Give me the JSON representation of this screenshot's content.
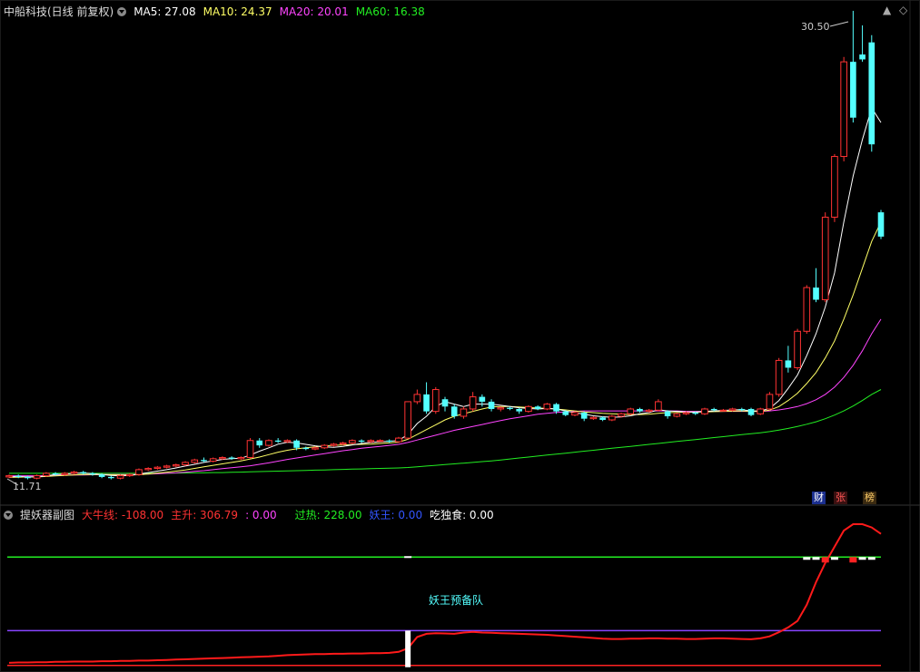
{
  "main_panel": {
    "stock": "中船科技(日线 前复权)",
    "ma": [
      {
        "label": "MA5: 27.08",
        "color": "#ffffff"
      },
      {
        "label": "MA10: 24.37",
        "color": "#ffff66"
      },
      {
        "label": "MA20: 20.01",
        "color": "#ff44ff"
      },
      {
        "label": "MA60: 16.38",
        "color": "#22ee22"
      }
    ],
    "high_label": "30.50",
    "low_label": "11.71",
    "badges": [
      {
        "text": "财",
        "color": "#ffffff",
        "bg": "#1b2f8f"
      },
      {
        "text": "张",
        "color": "#ff5555",
        "bg": "#3a1111"
      },
      {
        "text": "榜",
        "color": "#ffcc66",
        "bg": "#3a2a11"
      }
    ]
  },
  "sub_panel": {
    "name": "提妖器副图",
    "fields": [
      {
        "label": "大牛线: -108.00",
        "color": "#ff3333"
      },
      {
        "label": "主升: 306.79",
        "color": "#ff3333"
      },
      {
        "label": ": 0.00",
        "color": "#ff44ff"
      },
      {
        "label": "过热: 228.00",
        "color": "#22ee22"
      },
      {
        "label": "妖王: 0.00",
        "color": "#3355ff"
      },
      {
        "label": "吃独食: 0.00",
        "color": "#ffffff"
      }
    ],
    "annotation": "妖王预备队"
  },
  "colors": {
    "up": "#ff3333",
    "down": "#54ffff",
    "bg": "#000000"
  },
  "chart_data": {
    "type": "candlestick",
    "price_range": [
      11.71,
      30.5
    ],
    "candles": [
      [
        11.9,
        11.95,
        12.0,
        11.85
      ],
      [
        11.95,
        11.9,
        12.0,
        11.85
      ],
      [
        11.9,
        11.85,
        11.95,
        11.8
      ],
      [
        11.85,
        11.95,
        12.0,
        11.8
      ],
      [
        11.95,
        12.05,
        12.1,
        11.9
      ],
      [
        12.05,
        12.0,
        12.1,
        11.95
      ],
      [
        12.0,
        12.05,
        12.1,
        11.95
      ],
      [
        12.05,
        12.1,
        12.15,
        12.0
      ],
      [
        12.1,
        12.05,
        12.15,
        12.0
      ],
      [
        12.05,
        12.0,
        12.1,
        11.95
      ],
      [
        12.0,
        11.9,
        12.05,
        11.85
      ],
      [
        11.9,
        11.85,
        11.95,
        11.8
      ],
      [
        11.85,
        11.95,
        12.0,
        11.8
      ],
      [
        11.95,
        12.0,
        12.05,
        11.9
      ],
      [
        12.0,
        12.2,
        12.25,
        11.95
      ],
      [
        12.2,
        12.25,
        12.3,
        12.15
      ],
      [
        12.25,
        12.3,
        12.35,
        12.2
      ],
      [
        12.3,
        12.35,
        12.4,
        12.25
      ],
      [
        12.35,
        12.4,
        12.45,
        12.3
      ],
      [
        12.4,
        12.5,
        12.55,
        12.35
      ],
      [
        12.5,
        12.6,
        12.65,
        12.45
      ],
      [
        12.6,
        12.55,
        12.7,
        12.5
      ],
      [
        12.55,
        12.65,
        12.7,
        12.5
      ],
      [
        12.65,
        12.7,
        12.75,
        12.6
      ],
      [
        12.7,
        12.65,
        12.75,
        12.6
      ],
      [
        12.65,
        12.7,
        12.75,
        12.6
      ],
      [
        12.7,
        13.4,
        13.5,
        12.65
      ],
      [
        13.4,
        13.2,
        13.5,
        13.1
      ],
      [
        13.2,
        13.4,
        13.45,
        13.15
      ],
      [
        13.4,
        13.35,
        13.5,
        13.3
      ],
      [
        13.35,
        13.4,
        13.45,
        13.3
      ],
      [
        13.4,
        13.1,
        13.45,
        13.0
      ],
      [
        13.1,
        13.05,
        13.15,
        13.0
      ],
      [
        13.05,
        13.1,
        13.15,
        13.0
      ],
      [
        13.1,
        13.2,
        13.25,
        13.05
      ],
      [
        13.2,
        13.25,
        13.3,
        13.15
      ],
      [
        13.25,
        13.3,
        13.35,
        13.2
      ],
      [
        13.3,
        13.4,
        13.45,
        13.25
      ],
      [
        13.4,
        13.35,
        13.45,
        13.3
      ],
      [
        13.35,
        13.4,
        13.45,
        13.3
      ],
      [
        13.4,
        13.4,
        13.45,
        13.35
      ],
      [
        13.4,
        13.35,
        13.45,
        13.3
      ],
      [
        13.35,
        13.5,
        13.55,
        13.3
      ],
      [
        13.5,
        15.0,
        15.0,
        13.45
      ],
      [
        15.0,
        15.3,
        15.5,
        14.9
      ],
      [
        15.3,
        14.6,
        15.8,
        14.5
      ],
      [
        14.6,
        15.5,
        15.6,
        14.5
      ],
      [
        15.1,
        14.8,
        15.2,
        14.6
      ],
      [
        14.8,
        14.4,
        14.9,
        14.3
      ],
      [
        14.4,
        14.7,
        14.8,
        14.3
      ],
      [
        14.7,
        15.2,
        15.4,
        14.6
      ],
      [
        15.2,
        15.0,
        15.3,
        14.8
      ],
      [
        15.0,
        14.7,
        15.1,
        14.6
      ],
      [
        14.7,
        14.75,
        14.8,
        14.6
      ],
      [
        14.75,
        14.7,
        14.8,
        14.65
      ],
      [
        14.7,
        14.6,
        14.75,
        14.5
      ],
      [
        14.6,
        14.8,
        14.85,
        14.55
      ],
      [
        14.8,
        14.7,
        14.85,
        14.65
      ],
      [
        14.7,
        14.9,
        14.95,
        14.65
      ],
      [
        14.9,
        14.6,
        14.95,
        14.5
      ],
      [
        14.6,
        14.45,
        14.65,
        14.4
      ],
      [
        14.45,
        14.55,
        14.6,
        14.4
      ],
      [
        14.55,
        14.3,
        14.6,
        14.2
      ],
      [
        14.3,
        14.35,
        14.4,
        14.25
      ],
      [
        14.35,
        14.25,
        14.4,
        14.2
      ],
      [
        14.25,
        14.4,
        14.45,
        14.2
      ],
      [
        14.4,
        14.5,
        14.55,
        14.35
      ],
      [
        14.5,
        14.7,
        14.75,
        14.45
      ],
      [
        14.7,
        14.6,
        14.75,
        14.55
      ],
      [
        14.6,
        14.65,
        14.7,
        14.55
      ],
      [
        14.65,
        15.0,
        15.1,
        14.6
      ],
      [
        14.6,
        14.4,
        14.65,
        14.3
      ],
      [
        14.4,
        14.5,
        14.55,
        14.35
      ],
      [
        14.5,
        14.55,
        14.6,
        14.45
      ],
      [
        14.55,
        14.5,
        14.6,
        14.45
      ],
      [
        14.5,
        14.7,
        14.75,
        14.45
      ],
      [
        14.7,
        14.65,
        14.75,
        14.6
      ],
      [
        14.65,
        14.65,
        14.7,
        14.6
      ],
      [
        14.65,
        14.7,
        14.75,
        14.6
      ],
      [
        14.7,
        14.65,
        14.75,
        14.6
      ],
      [
        14.7,
        14.45,
        14.75,
        14.4
      ],
      [
        14.5,
        14.7,
        14.75,
        14.45
      ],
      [
        14.7,
        15.3,
        15.4,
        14.65
      ],
      [
        15.3,
        16.7,
        16.8,
        15.2
      ],
      [
        16.7,
        16.4,
        17.3,
        16.2
      ],
      [
        16.4,
        17.9,
        18.0,
        16.3
      ],
      [
        17.9,
        19.7,
        19.8,
        17.8
      ],
      [
        19.7,
        19.2,
        20.5,
        19.1
      ],
      [
        19.2,
        22.6,
        22.8,
        19.1
      ],
      [
        22.6,
        25.1,
        25.2,
        22.4
      ],
      [
        25.1,
        29.0,
        29.2,
        24.9
      ],
      [
        29.0,
        26.7,
        31.1,
        26.5
      ],
      [
        29.3,
        29.1,
        30.5,
        29.0
      ],
      [
        29.8,
        25.6,
        30.1,
        25.3
      ],
      [
        22.8,
        21.8,
        22.9,
        21.7
      ]
    ],
    "ma5": [
      11.9,
      11.92,
      11.9,
      11.9,
      11.95,
      12,
      12.02,
      12.05,
      12.06,
      12.04,
      12,
      11.96,
      11.95,
      11.96,
      12.02,
      12.08,
      12.14,
      12.2,
      12.27,
      12.35,
      12.42,
      12.5,
      12.56,
      12.62,
      12.65,
      12.67,
      12.8,
      12.96,
      13.1,
      13.25,
      13.33,
      13.3,
      13.24,
      13.18,
      13.14,
      13.12,
      13.16,
      13.22,
      13.28,
      13.32,
      13.35,
      13.37,
      13.4,
      13.65,
      14.1,
      14.4,
      14.8,
      15.0,
      14.9,
      14.8,
      14.9,
      14.9,
      14.9,
      14.85,
      14.8,
      14.75,
      14.72,
      14.7,
      14.72,
      14.7,
      14.62,
      14.55,
      14.48,
      14.42,
      14.38,
      14.36,
      14.37,
      14.42,
      14.5,
      14.55,
      14.67,
      14.62,
      14.6,
      14.58,
      14.57,
      14.6,
      14.62,
      14.64,
      14.66,
      14.67,
      14.62,
      14.62,
      14.72,
      15.05,
      15.55,
      16.1,
      16.9,
      17.8,
      18.9,
      20.3,
      22.4,
      24.3,
      25.8,
      27.1,
      26.5
    ],
    "ma10": [
      11.88,
      11.89,
      11.9,
      11.9,
      11.92,
      11.94,
      11.96,
      11.98,
      12.0,
      12.0,
      12.0,
      11.99,
      11.98,
      11.98,
      11.99,
      12.02,
      12.06,
      12.1,
      12.14,
      12.19,
      12.25,
      12.32,
      12.38,
      12.44,
      12.5,
      12.56,
      12.64,
      12.72,
      12.82,
      12.92,
      13.0,
      13.06,
      13.1,
      13.14,
      13.18,
      13.2,
      13.22,
      13.23,
      13.24,
      13.25,
      13.28,
      13.3,
      13.33,
      13.45,
      13.65,
      13.85,
      14.05,
      14.25,
      14.4,
      14.5,
      14.6,
      14.7,
      14.78,
      14.8,
      14.8,
      14.78,
      14.76,
      14.74,
      14.72,
      14.7,
      14.66,
      14.62,
      14.58,
      14.55,
      14.52,
      14.5,
      14.48,
      14.47,
      14.47,
      14.48,
      14.52,
      14.55,
      14.56,
      14.57,
      14.57,
      14.58,
      14.59,
      14.6,
      14.61,
      14.62,
      14.6,
      14.6,
      14.65,
      14.8,
      15.05,
      15.35,
      15.75,
      16.2,
      16.8,
      17.5,
      18.4,
      19.4,
      20.5,
      21.6,
      22.4
    ],
    "ma20": [
      11.95,
      11.95,
      11.95,
      11.95,
      11.95,
      11.96,
      11.97,
      11.98,
      11.98,
      11.99,
      12.0,
      12.0,
      12.0,
      12.0,
      12.01,
      12.02,
      12.03,
      12.05,
      12.07,
      12.1,
      12.13,
      12.16,
      12.2,
      12.24,
      12.28,
      12.32,
      12.36,
      12.42,
      12.48,
      12.55,
      12.62,
      12.68,
      12.74,
      12.8,
      12.86,
      12.92,
      12.98,
      13.03,
      13.08,
      13.12,
      13.16,
      13.2,
      13.24,
      13.32,
      13.42,
      13.52,
      13.62,
      13.72,
      13.82,
      13.9,
      13.98,
      14.06,
      14.14,
      14.22,
      14.3,
      14.36,
      14.42,
      14.48,
      14.52,
      14.56,
      14.58,
      14.6,
      14.62,
      14.62,
      14.62,
      14.62,
      14.62,
      14.62,
      14.62,
      14.62,
      14.62,
      14.62,
      14.62,
      14.6,
      14.6,
      14.6,
      14.6,
      14.6,
      14.6,
      14.6,
      14.6,
      14.6,
      14.62,
      14.66,
      14.72,
      14.8,
      14.92,
      15.08,
      15.3,
      15.6,
      16.0,
      16.5,
      17.1,
      17.8,
      18.4
    ],
    "ma60": [
      12.05,
      12.05,
      12.05,
      12.05,
      12.05,
      12.05,
      12.05,
      12.05,
      12.05,
      12.05,
      12.05,
      12.05,
      12.05,
      12.05,
      12.05,
      12.05,
      12.05,
      12.05,
      12.06,
      12.06,
      12.07,
      12.07,
      12.08,
      12.08,
      12.09,
      12.1,
      12.11,
      12.12,
      12.13,
      12.14,
      12.15,
      12.16,
      12.17,
      12.18,
      12.19,
      12.2,
      12.21,
      12.22,
      12.23,
      12.24,
      12.25,
      12.26,
      12.27,
      12.29,
      12.32,
      12.35,
      12.38,
      12.41,
      12.44,
      12.47,
      12.5,
      12.53,
      12.56,
      12.6,
      12.64,
      12.68,
      12.72,
      12.76,
      12.8,
      12.84,
      12.88,
      12.92,
      12.96,
      13.0,
      13.04,
      13.08,
      13.12,
      13.16,
      13.2,
      13.24,
      13.28,
      13.32,
      13.36,
      13.4,
      13.44,
      13.48,
      13.52,
      13.56,
      13.6,
      13.64,
      13.68,
      13.72,
      13.77,
      13.83,
      13.9,
      13.98,
      14.07,
      14.17,
      14.3,
      14.45,
      14.62,
      14.82,
      15.05,
      15.3,
      15.5
    ],
    "sub_line": [
      -100,
      -99,
      -99,
      -98,
      -98,
      -97,
      -97,
      -96,
      -96,
      -96,
      -95,
      -95,
      -94,
      -94,
      -93,
      -93,
      -92,
      -91,
      -90,
      -89,
      -88,
      -87,
      -86,
      -85,
      -84,
      -83,
      -82,
      -81,
      -80,
      -78,
      -76,
      -75,
      -74,
      -73,
      -73,
      -72,
      -72,
      -71,
      -71,
      -70,
      -70,
      -69,
      -66,
      -55,
      -20,
      -10,
      -8,
      -9,
      -10,
      -6,
      -4,
      -6,
      -7,
      -8,
      -9,
      -10,
      -11,
      -12,
      -13,
      -15,
      -17,
      -19,
      -21,
      -23,
      -25,
      -26,
      -26,
      -25,
      -25,
      -24,
      -24,
      -25,
      -25,
      -26,
      -26,
      -25,
      -24,
      -24,
      -25,
      -26,
      -27,
      -24,
      -18,
      -5,
      10,
      30,
      80,
      150,
      210,
      260,
      310,
      330,
      330,
      320,
      300
    ],
    "sub_levels": {
      "green": 228,
      "purple": 0,
      "red": -108
    },
    "sub_range": [
      -120,
      330
    ]
  }
}
